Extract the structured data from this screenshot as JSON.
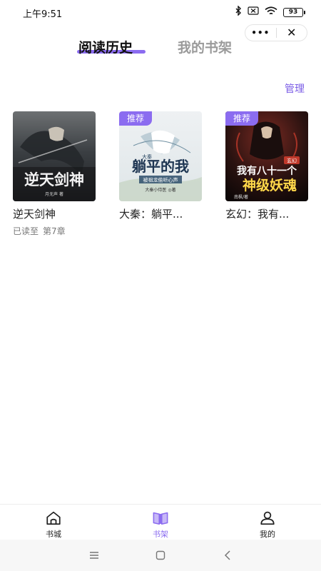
{
  "status_bar": {
    "time": "上午9:51",
    "battery": "93",
    "icons": [
      "bluetooth-icon",
      "sim-off-icon",
      "wifi-icon",
      "battery-icon"
    ]
  },
  "capsule": {
    "more_icon": "more-dots-icon",
    "close_icon": "close-icon"
  },
  "tabs": [
    {
      "label": "阅读历史",
      "active": true
    },
    {
      "label": "我的书架",
      "active": false
    }
  ],
  "manage_label": "管理",
  "books": [
    {
      "title": "逆天剑神",
      "progress_label": "已读至",
      "progress_value": "第7章",
      "badge": "",
      "cover_text": "逆天剑神",
      "cover_author": "月无声 著"
    },
    {
      "title": "大秦：躺平...",
      "badge": "推荐",
      "cover_text": "躺平的我",
      "cover_top": "大秦",
      "cover_sub": "被祖龙偷听心声",
      "cover_author": "大秦小侍医 ◎著"
    },
    {
      "title": "玄幻：我有...",
      "badge": "推荐",
      "cover_text": "我有八十一个",
      "cover_text2": "神级妖魂",
      "cover_tag": "玄幻",
      "cover_author": "南枫/著"
    }
  ],
  "bottom_nav": [
    {
      "label": "书城",
      "icon": "home-icon",
      "active": false
    },
    {
      "label": "书架",
      "icon": "book-icon",
      "active": true
    },
    {
      "label": "我的",
      "icon": "user-icon",
      "active": false
    }
  ],
  "colors": {
    "accent": "#8b6cf0",
    "manage": "#7b5ce6",
    "inactive_tab": "#9a9a9a"
  }
}
